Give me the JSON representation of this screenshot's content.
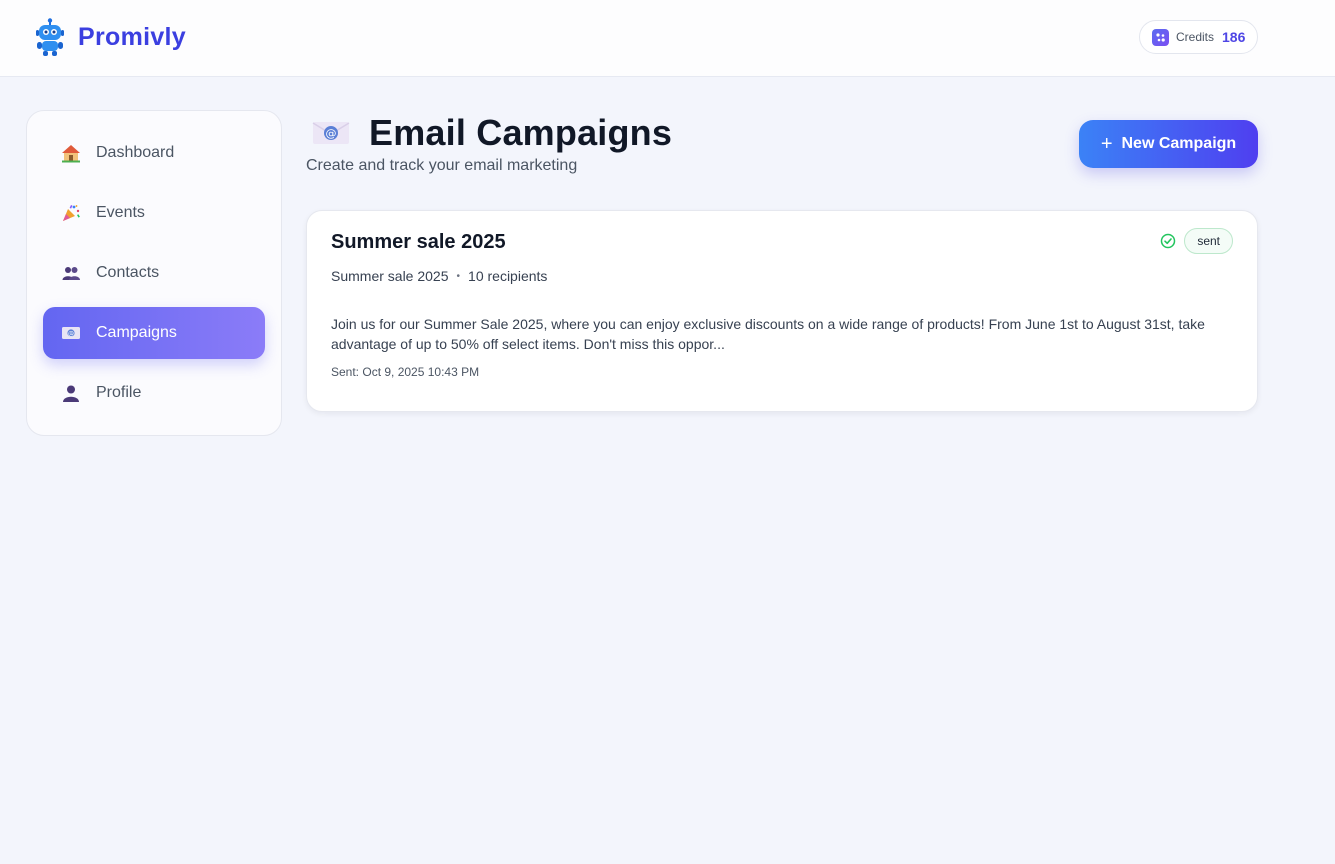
{
  "brand": {
    "name": "Promivly",
    "logo_icon": "robot-icon"
  },
  "credits": {
    "label": "Credits",
    "value": "186",
    "icon": "sparkle-icon"
  },
  "sidebar": {
    "items": [
      {
        "label": "Dashboard",
        "icon": "house-icon",
        "active": false
      },
      {
        "label": "Events",
        "icon": "party-popper-icon",
        "active": false
      },
      {
        "label": "Contacts",
        "icon": "people-icon",
        "active": false
      },
      {
        "label": "Campaigns",
        "icon": "email-icon",
        "active": true
      },
      {
        "label": "Profile",
        "icon": "person-icon",
        "active": false
      }
    ]
  },
  "page": {
    "title": "Email Campaigns",
    "title_icon": "email-envelope-icon",
    "subtitle": "Create and track your email marketing",
    "new_button_label": "New Campaign"
  },
  "campaigns": [
    {
      "title": "Summer sale 2025",
      "subject": "Summer sale 2025",
      "recipients": "10 recipients",
      "status": "sent",
      "body": "Join us for our Summer Sale 2025, where you can enjoy exclusive discounts on a wide range of products! From June 1st to August 31st, take advantage of up to 50% off select items. Don't miss this oppor...",
      "sent_at": "Sent: Oct 9, 2025 10:43 PM"
    }
  ],
  "colors": {
    "accent": "#4f46e5",
    "brand": "#3b3fe0",
    "active_nav_start": "#6366f1",
    "active_nav_end": "#8b7cf8",
    "button_start": "#3b82f6",
    "button_end": "#4f3ff0",
    "status_sent": "#22c55e",
    "background": "#f3f5fc"
  }
}
